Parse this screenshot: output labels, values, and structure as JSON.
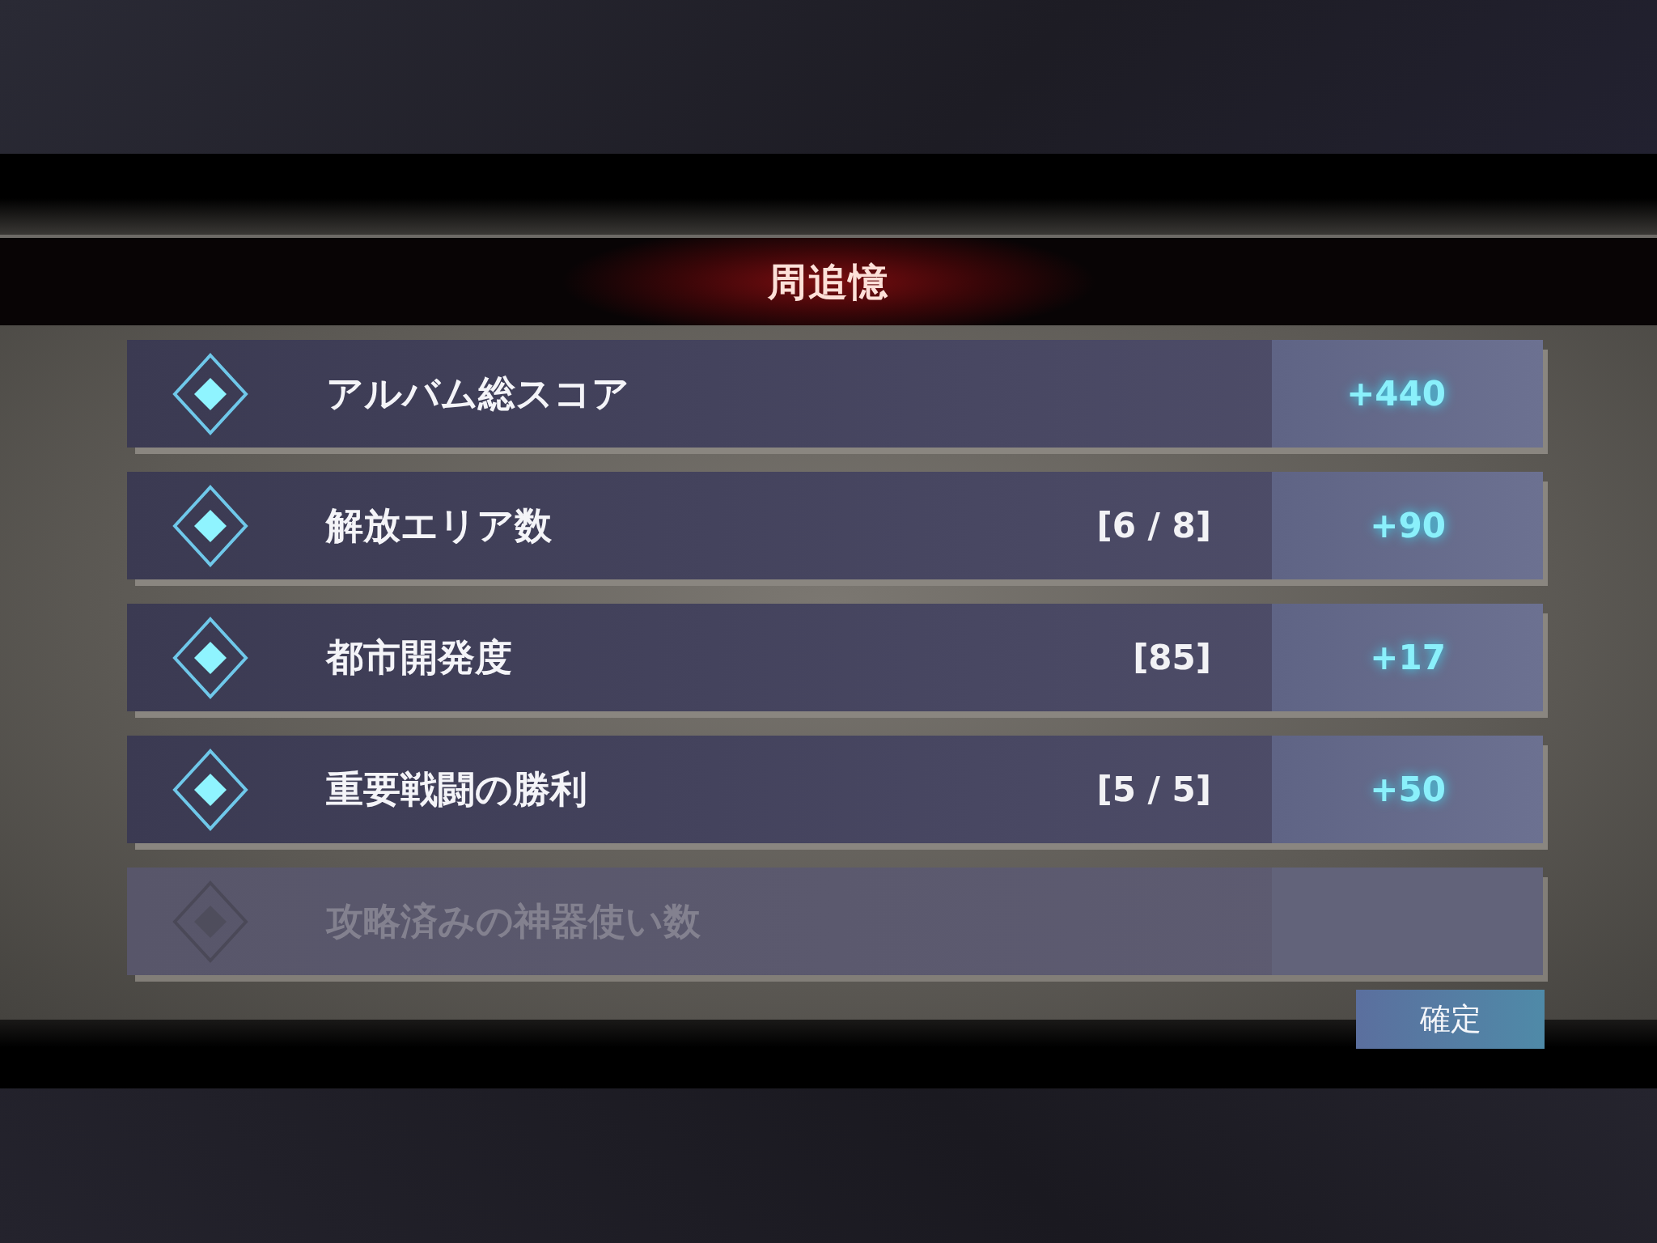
{
  "title": "周追憶",
  "rows": [
    {
      "label": "アルバム総スコア",
      "bonus": "+440",
      "disabled": false
    },
    {
      "label": "解放エリア数",
      "counter": "[6 / 8]",
      "bonus": "+90",
      "disabled": false
    },
    {
      "label": "都市開発度",
      "counter": "[85]",
      "bonus": "+17",
      "disabled": false
    },
    {
      "label": "重要戦闘の勝利",
      "counter": "[5 / 5]",
      "bonus": "+50",
      "disabled": false
    },
    {
      "label": "攻略済みの神器使い数",
      "disabled": true
    }
  ],
  "confirm_button": "確定"
}
